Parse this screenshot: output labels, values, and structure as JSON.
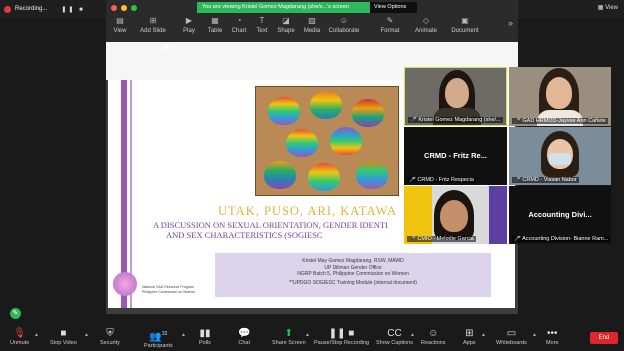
{
  "recording": {
    "label": "Recording...",
    "controls": "❚❚ ■"
  },
  "banner": {
    "viewing": "You are viewing Kristel Gomez Magdarang (she/s...'s screen",
    "view_options": "View Options",
    "view": "View"
  },
  "ribbon": [
    "View",
    "Add Slide",
    "Play",
    "Table",
    "Chart",
    "Text",
    "Shape",
    "Media",
    "Collaborate",
    "Format",
    "Animate",
    "Document"
  ],
  "slide": {
    "title1": "UTAK, PUSO, ARI, KATAWA",
    "title2": "A DISCUSSION ON SEXUAL ORIENTATION, GENDER IDENTI",
    "title3": "AND SEX CHARACTERISTICS (SOGIESC",
    "author_name": "Kristel May Gomez Magdarang, RSW,  MAWD",
    "author_org": "UP  Diliman  Gender  Office",
    "author_batch": "NGRP Batch 5, Philippine Commission on Women",
    "doc_note": "**UPDGO SOGIESC Training Module (internal document)",
    "logo_text": "National GAD Resource Program\nPhilippine Commission on Women"
  },
  "participants": [
    {
      "name": "Kristel Gomez Magdarang (she/...",
      "big": "",
      "video": true
    },
    {
      "name": "GAD HRMDD-Jayvee Ann Cañete",
      "big": "",
      "video": true
    },
    {
      "name": "CRMD - Fritz Respecia",
      "big": "CRMD - Fritz Re...",
      "video": false
    },
    {
      "name": "CRMD - Vissan Nabor",
      "big": "",
      "video": true
    },
    {
      "name": "CMIO - Melodie Garcia",
      "big": "",
      "video": true
    },
    {
      "name": "Accounting Division- Bianne Ram...",
      "big": "Accounting  Divi...",
      "video": false
    }
  ],
  "controls": {
    "unmute": "Unmute",
    "stop_video": "Stop Video",
    "security": "Security",
    "participants": "Participants",
    "participants_count": "32",
    "polls": "Polls",
    "chat": "Chat",
    "share_screen": "Share Screen",
    "pause_recording": "Pause/Stop Recording",
    "captions": "Show Captions",
    "reactions": "Reactions",
    "apps": "Apps",
    "whiteboards": "Whiteboards",
    "more": "More",
    "end": "End"
  },
  "colors": {
    "accent_green": "#2eb85c",
    "end_red": "#e0252c",
    "slide_purple": "#7d3c98",
    "slide_gold": "#e2b43a"
  }
}
